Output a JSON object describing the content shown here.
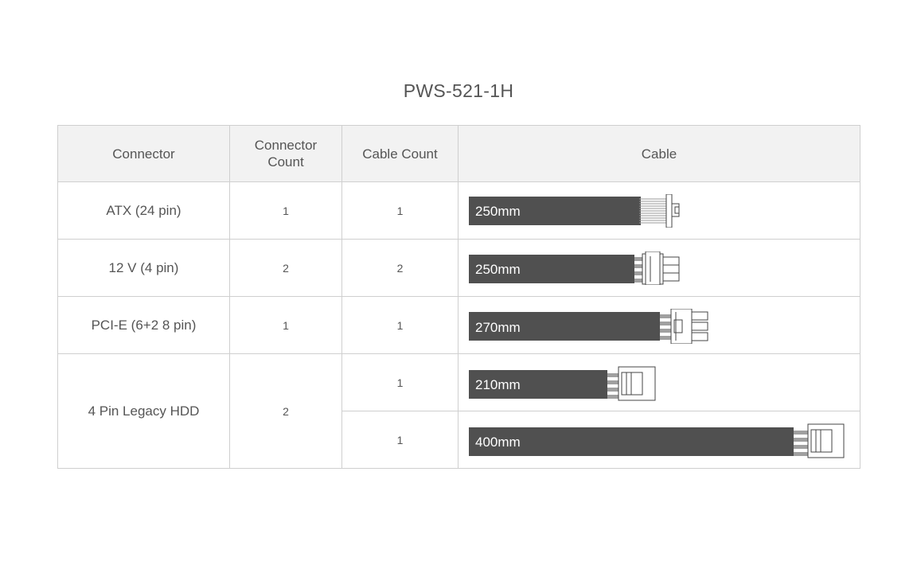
{
  "title": "PWS-521-1H",
  "columns": [
    "Connector",
    "Connector Count",
    "Cable Count",
    "Cable"
  ],
  "rows": [
    {
      "connector": "ATX (24 pin)",
      "connector_count": "1",
      "cables": [
        {
          "cable_count": "1",
          "length": "250mm",
          "connector_type": "atx-24pin-icon"
        }
      ]
    },
    {
      "connector": "12 V (4 pin)",
      "connector_count": "2",
      "cables": [
        {
          "cable_count": "2",
          "length": "250mm",
          "connector_type": "cpu-4pin-icon"
        }
      ]
    },
    {
      "connector": "PCI-E (6+2 8 pin)",
      "connector_count": "1",
      "cables": [
        {
          "cable_count": "1",
          "length": "270mm",
          "connector_type": "pcie-8pin-icon"
        }
      ]
    },
    {
      "connector": "4 Pin Legacy HDD",
      "connector_count": "2",
      "cables": [
        {
          "cable_count": "1",
          "length": "210mm",
          "connector_type": "molex-4pin-icon"
        },
        {
          "cable_count": "1",
          "length": "400mm",
          "connector_type": "molex-4pin-icon"
        }
      ]
    }
  ],
  "colors": {
    "cable": "#505050",
    "header_bg": "#f2f2f2",
    "border": "#cfcfcf",
    "text": "#555555"
  }
}
